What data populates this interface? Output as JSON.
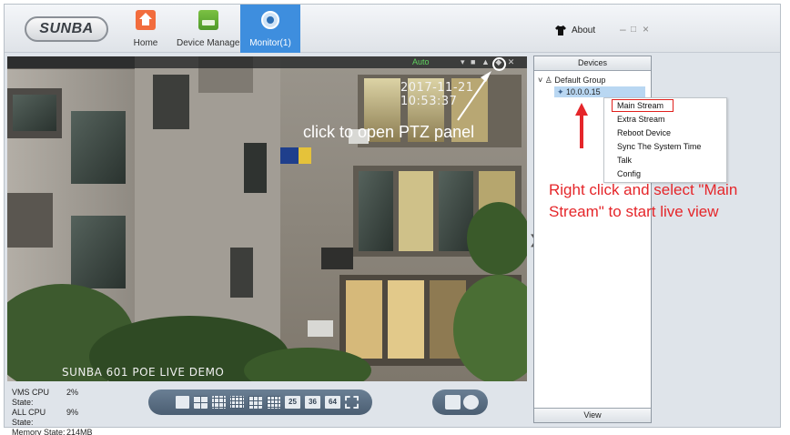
{
  "app": {
    "logo": "SUNBA",
    "nav": [
      {
        "label": "Home"
      },
      {
        "label": "Device Manager"
      },
      {
        "label": "Monitor(1)"
      }
    ],
    "about_label": "About",
    "window_controls": {
      "minimize": "–",
      "maximize": "□",
      "close": "×"
    }
  },
  "video": {
    "mode": "Auto",
    "timestamp": "2017-11-21 10:53:37",
    "channel_name": "SUNBA 601 POE LIVE DEMO",
    "annotation": "click to open PTZ panel"
  },
  "stats": [
    {
      "label": "VMS CPU State:",
      "value": "2%"
    },
    {
      "label": "ALL CPU State:",
      "value": "9%"
    },
    {
      "label": "Memory State:",
      "value": "214MB"
    }
  ],
  "layout_buttons": {
    "n25": "25",
    "n36": "36",
    "n64": "64"
  },
  "devices": {
    "header": "Devices",
    "footer": "View",
    "group": "Default Group",
    "device": "10.0.0.15"
  },
  "context_menu": [
    "Main Stream",
    "Extra Stream",
    "Reboot Device",
    "Sync The System Time",
    "Talk",
    "Config"
  ],
  "annotation_right": {
    "line1": "Right click and select \"Main",
    "line2": "Stream\" to start live view"
  },
  "colors": {
    "accent": "#3e8ede",
    "annotation_red": "#e5262a",
    "auto_green": "#5fd35f"
  }
}
